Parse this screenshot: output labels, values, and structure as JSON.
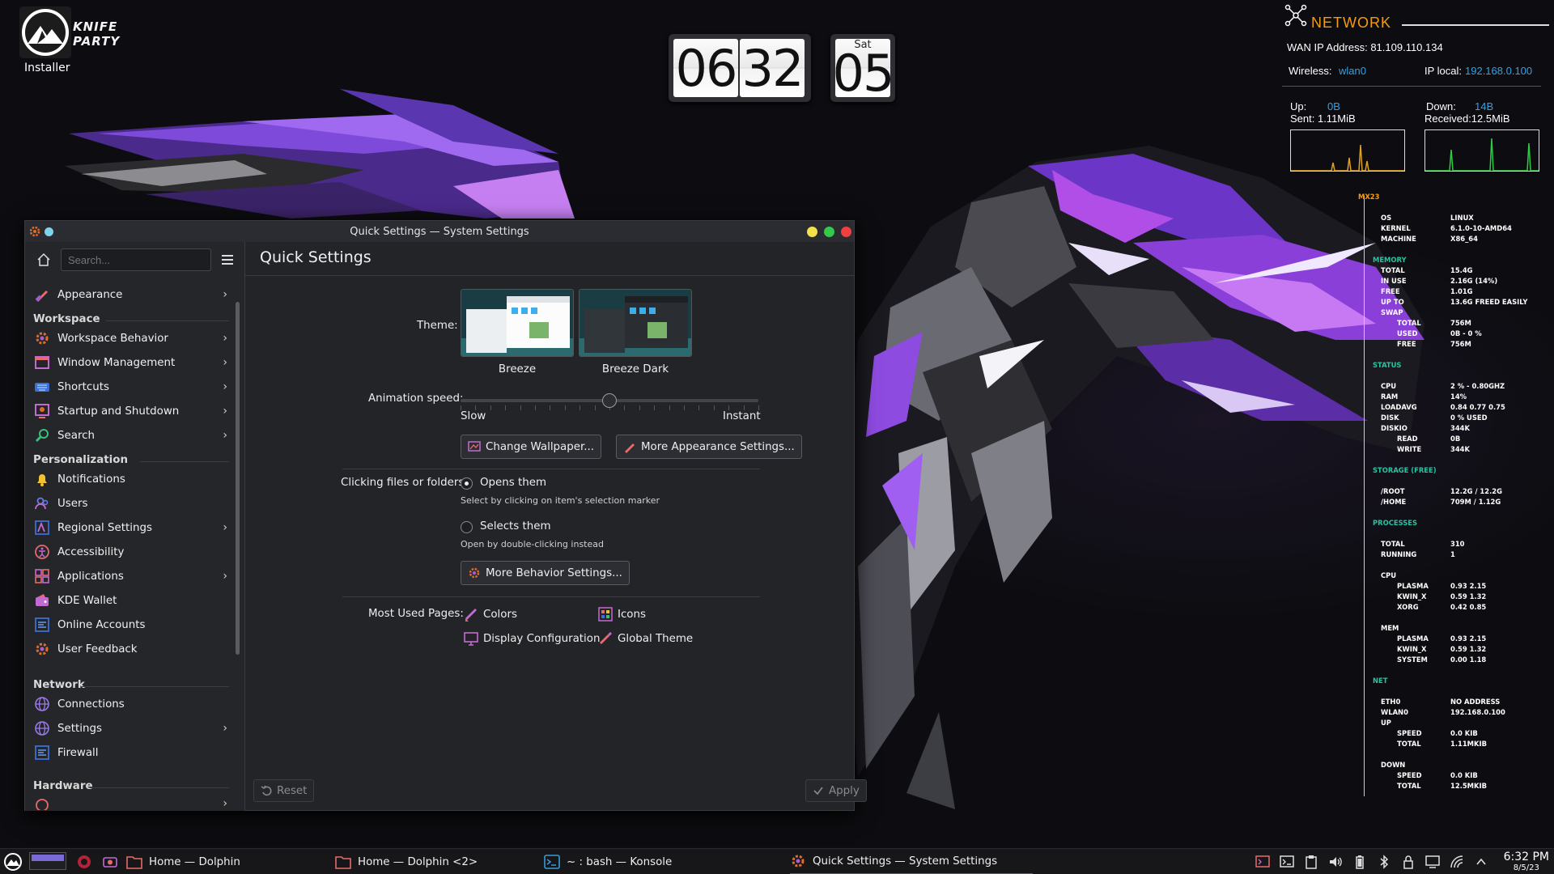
{
  "desktop": {
    "installer_label": "Installer",
    "brand_text": "KNIFE PARTY"
  },
  "flip_clock": {
    "hour": "06",
    "minute": "32",
    "weekday": "Sat",
    "date": "05"
  },
  "network_widget": {
    "title": "NETWORK",
    "wan_label": "WAN IP Address: 81.109.110.134",
    "wireless_label": "Wireless:",
    "wireless_value": "wlan0",
    "ip_local_label": "IP local:",
    "ip_local_value": "192.168.0.100",
    "up_label": "Up:",
    "up_value": "0B",
    "sent": "Sent: 1.11MiB",
    "down_label": "Down:",
    "down_value": "14B",
    "received": "Received:12.5MiB",
    "colors": {
      "title": "#f39c12",
      "link": "#2ea3e8",
      "up_graph": "#e0a020",
      "down_graph": "#2ecc40"
    }
  },
  "conky": {
    "mx23": "MX23",
    "os_k": "OS",
    "os_v": "LINUX",
    "kernel_k": "KERNEL",
    "kernel_v": "6.1.0-10-AMD64",
    "machine_k": "MACHINE",
    "machine_v": "X86_64",
    "memory": "MEMORY",
    "total_k": "TOTAL",
    "total_v": "15.4G",
    "inuse_k": "IN USE",
    "inuse_v": "2.16G (14%)",
    "free_k": "FREE",
    "free_v": "1.01G",
    "upto_k": "UP TO",
    "upto_v": "13.6G FREED EASILY",
    "swap_k": "SWAP",
    "swtotal_k": "TOTAL",
    "swtotal_v": "756M",
    "swused_k": "USED",
    "swused_v": "0B   - 0 %",
    "swfree_k": "FREE",
    "swfree_v": "756M",
    "status": "STATUS",
    "cpu_k": "CPU",
    "cpu_v": "2 % - 0.80GHZ",
    "ram_k": "RAM",
    "ram_v": "14%",
    "loadavg_k": "LOADAVG",
    "loadavg_v": "0.84 0.77 0.75",
    "disk_k": "DISK",
    "disk_v": "0 % USED",
    "diskio_k": "DISKIO",
    "diskio_v": "344K",
    "read_k": "READ",
    "read_v": "0B",
    "write_k": "WRITE",
    "write_v": "344K",
    "storage": "STORAGE (FREE)",
    "root_k": "/ROOT",
    "root_v": "12.2G / 12.2G",
    "home_k": "/HOME",
    "home_v": "709M  / 1.12G",
    "processes": "PROCESSES",
    "ptotal_k": "TOTAL",
    "ptotal_v": "310",
    "running_k": "RUNNING",
    "running_v": "1",
    "pcpu_k": "CPU",
    "plasma_k": "PLASMA",
    "plasma_v": "0.93  2.15",
    "kwin_k": "KWIN_X",
    "kwin_v": "0.59  1.32",
    "xorg_k": "XORG",
    "xorg_v": "0.42  0.85",
    "mem_k": "MEM",
    "mplasma_k": "PLASMA",
    "mplasma_v": "0.93  2.15",
    "mkwin_k": "KWIN_X",
    "mkwin_v": "0.59  1.32",
    "msys_k": "SYSTEM",
    "msys_v": "0.00  1.18",
    "net": "NET",
    "eth0_k": "ETH0",
    "eth0_v": "NO ADDRESS",
    "wlan0_k": "WLAN0",
    "wlan0_v": "192.168.0.100",
    "up_k": "UP",
    "upspeed_k": "SPEED",
    "upspeed_v": "0.0    KIB",
    "uptotal_k": "TOTAL",
    "uptotal_v": "1.11MKIB",
    "down_k": "DOWN",
    "dnspeed_k": "SPEED",
    "dnspeed_v": "0.0    KIB",
    "dntotal_k": "TOTAL",
    "dntotal_v": "12.5MKIB"
  },
  "window": {
    "title": "Quick Settings — System Settings",
    "search_placeholder": "Search...",
    "page_title": "Quick Settings",
    "sidebar": {
      "appearance": "Appearance",
      "workspace_head": "Workspace",
      "workspace_behavior": "Workspace Behavior",
      "window_management": "Window Management",
      "shortcuts": "Shortcuts",
      "startup": "Startup and Shutdown",
      "search": "Search",
      "personalization_head": "Personalization",
      "notifications": "Notifications",
      "users": "Users",
      "regional": "Regional Settings",
      "accessibility": "Accessibility",
      "applications": "Applications",
      "kde_wallet": "KDE Wallet",
      "online_accounts": "Online Accounts",
      "user_feedback": "User Feedback",
      "network_head": "Network",
      "connections": "Connections",
      "settings": "Settings",
      "firewall": "Firewall",
      "hardware_head": "Hardware"
    },
    "theme_label": "Theme:",
    "theme_breeze": "Breeze",
    "theme_breeze_dark": "Breeze Dark",
    "animation_label": "Animation speed:",
    "animation_value": 0.5,
    "slow": "Slow",
    "instant": "Instant",
    "change_wallpaper": "Change Wallpaper...",
    "more_appearance": "More Appearance Settings...",
    "clicking_label": "Clicking files or folders:",
    "opens_them": "Opens them",
    "opens_hint": "Select by clicking on item's selection marker",
    "selects_them": "Selects them",
    "selects_hint": "Open by double-clicking instead",
    "more_behavior": "More Behavior Settings...",
    "most_used_label": "Most Used Pages:",
    "mu_colors": "Colors",
    "mu_icons": "Icons",
    "mu_display": "Display Configuration",
    "mu_global": "Global Theme",
    "reset": "Reset",
    "apply": "Apply"
  },
  "taskbar": {
    "task1": "Home — Dolphin",
    "task2": "Home — Dolphin <2>",
    "task3": "~ : bash — Konsole",
    "task4": "Quick Settings — System Settings",
    "time": "6:32 PM",
    "date": "8/5/23"
  }
}
